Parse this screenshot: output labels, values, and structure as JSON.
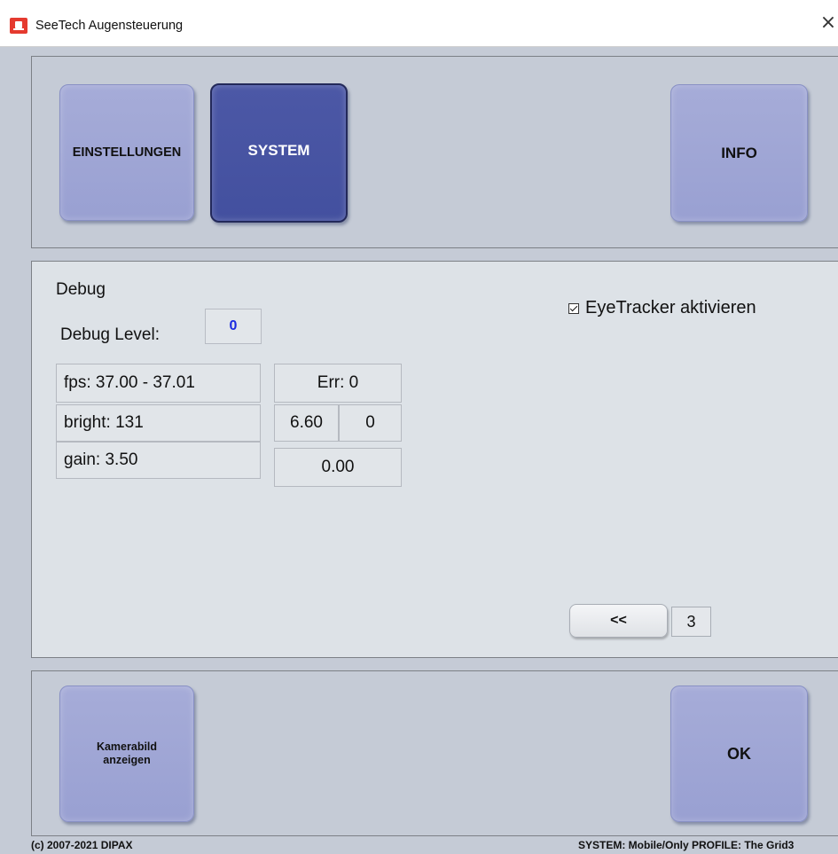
{
  "window": {
    "title": "SeeTech Augensteuerung",
    "close_glyph": "×",
    "icon": "app-icon"
  },
  "top_nav": {
    "einstellungen_label": "EINSTELLUNGEN",
    "system_label": "SYSTEM",
    "info_label": "INFO",
    "active_tab": "SYSTEM"
  },
  "debug": {
    "heading": "Debug",
    "level_label": "Debug Level:",
    "level_value": "0",
    "fps": "fps: 37.00 - 37.01",
    "bright": "bright: 131",
    "gain": "gain: 3.50",
    "err": "Err: 0",
    "value_1": "6.60",
    "value_2": "0",
    "value_3": "0.00"
  },
  "eyetracker": {
    "label": "EyeTracker aktivieren",
    "checked": true
  },
  "pager": {
    "back_label": "<<",
    "page": "3"
  },
  "bottom": {
    "kamera_line1": "Kamerabild",
    "kamera_line2": "anzeigen",
    "ok_label": "OK"
  },
  "footer": {
    "copyright": "(c) 2007-2021 DIPAX",
    "status": "SYSTEM: Mobile/Only  PROFILE: The Grid3"
  },
  "colors": {
    "active_button": "#4c58a6",
    "button": "#a6acd8",
    "debug_level_value": "#1a2ae0",
    "background": "#c5cbd6"
  }
}
